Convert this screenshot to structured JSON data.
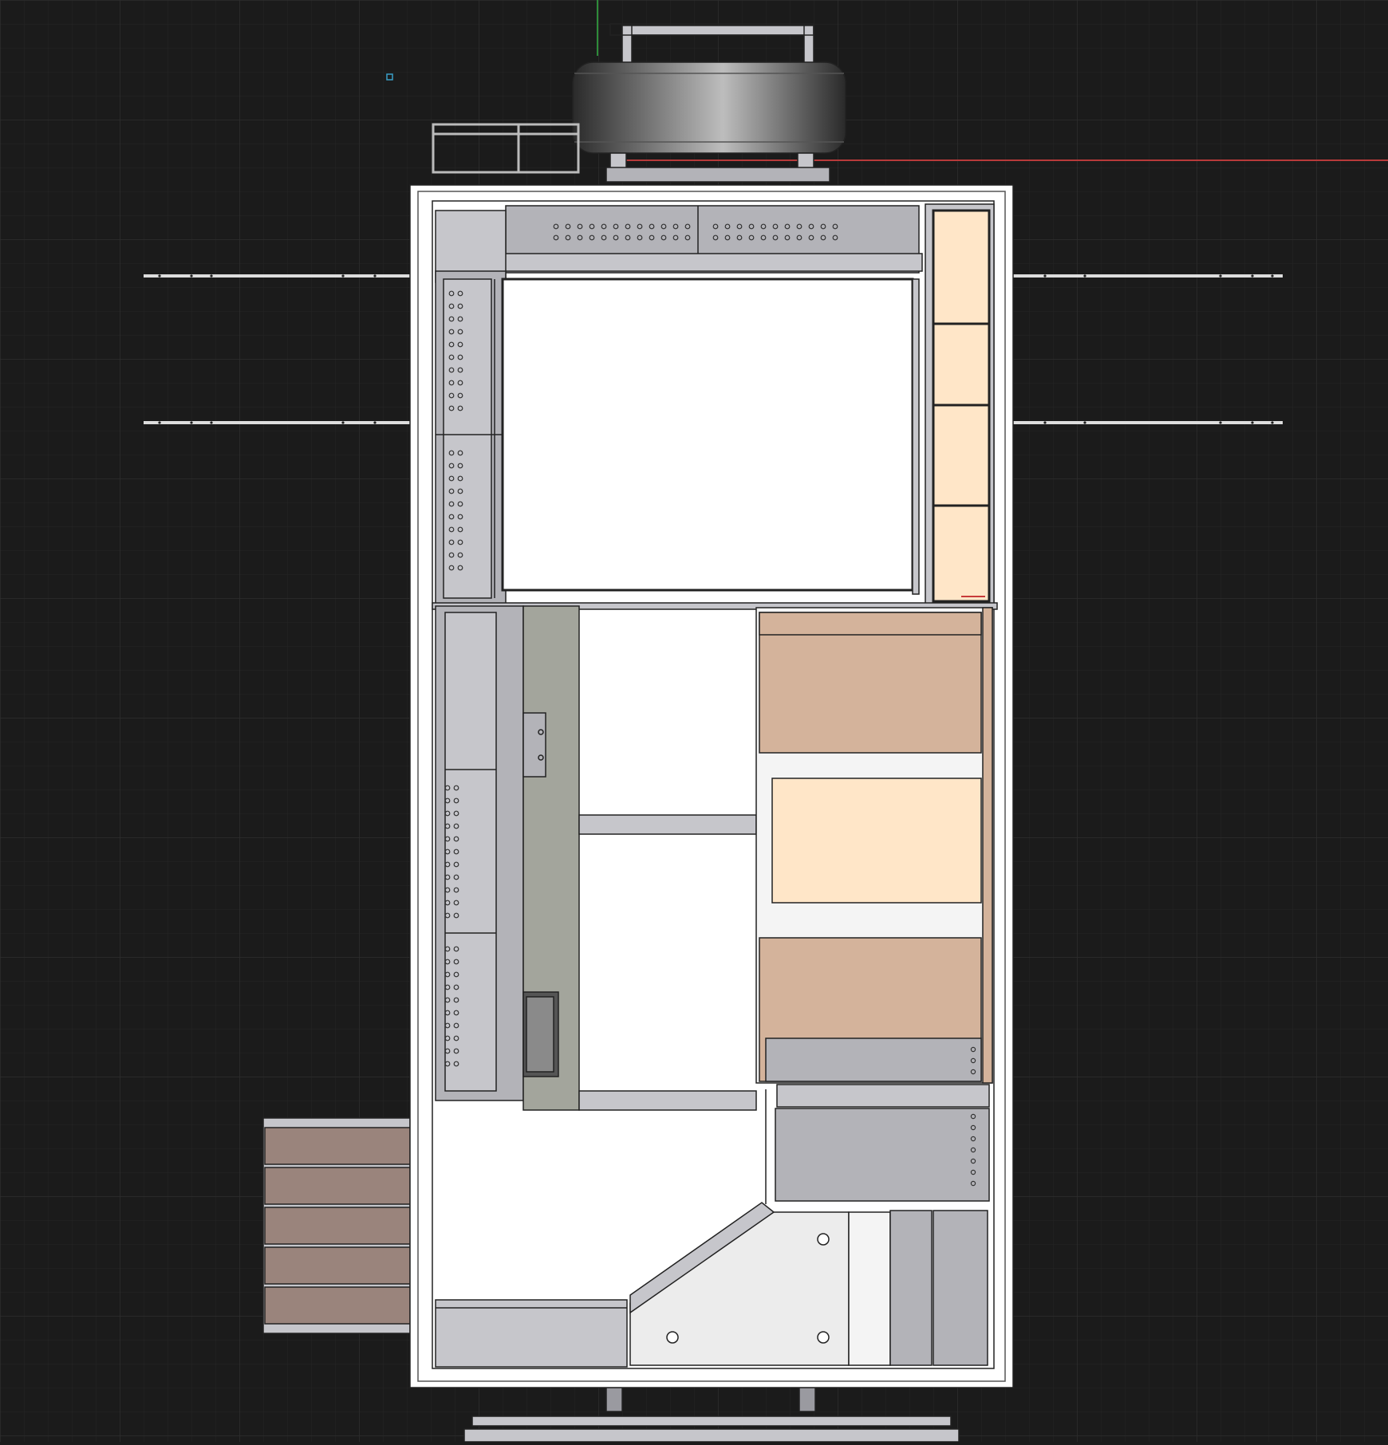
{
  "viewport": {
    "background": "#1b1b1b",
    "grid_minor": "#262626",
    "grid_major": "#2e2e2e",
    "axis_x_color": "#b83a3a",
    "axis_y_color": "#2e8b3a"
  },
  "palette": {
    "outline": "#222222",
    "steel": "#b3b3b8",
    "steel_light": "#c6c6cb",
    "panel_white": "#ffffff",
    "cushion": "#ffe6c8",
    "wood": "#d4b39b",
    "step_wood": "#9a847c",
    "counter": "#a3a59c",
    "tire_dark": "#2a2a2a",
    "tire_light": "#bdbdbd",
    "plate": "#ececec"
  },
  "icons": {
    "origin_marker": "origin-marker-icon",
    "handle": "drawer-handle-icon",
    "sink": "sink-icon"
  }
}
